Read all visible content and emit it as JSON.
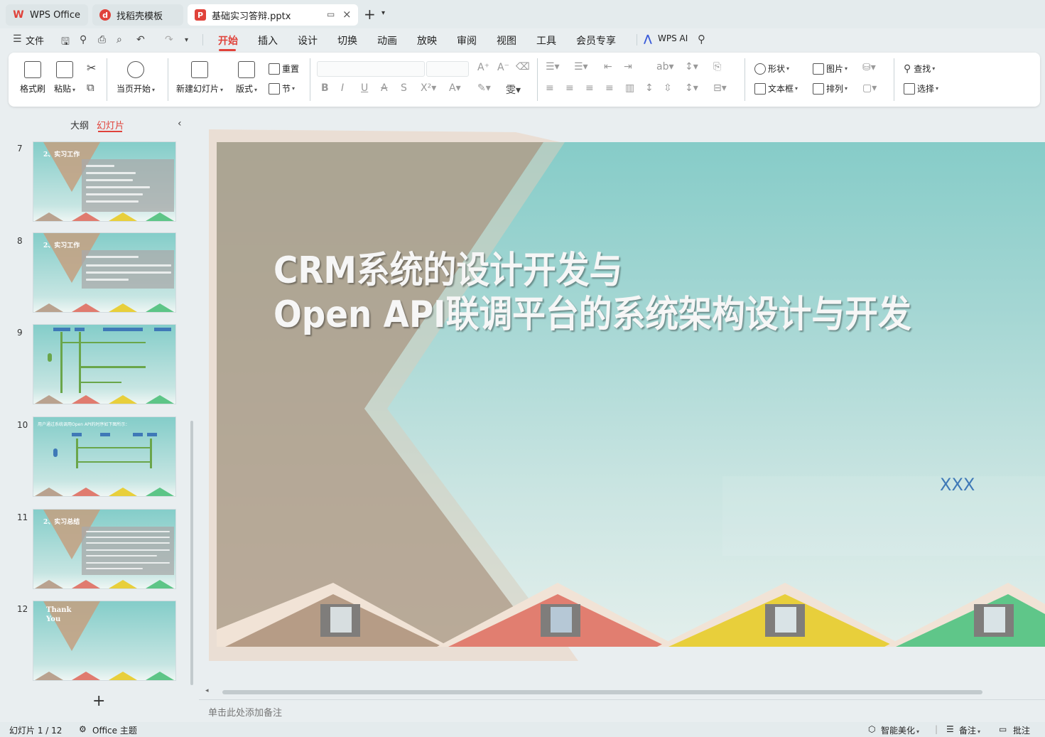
{
  "tabs": [
    {
      "label": "WPS Office",
      "icon": "wps-logo-icon",
      "color": "#e0423a"
    },
    {
      "label": "找稻壳模板",
      "icon": "docer-logo-icon",
      "color": "#e0423a"
    },
    {
      "label": "基础实习答辩.pptx",
      "icon": "ppt-file-icon",
      "color": "#e0423a",
      "active": true
    }
  ],
  "menu": {
    "file_label": "文件",
    "items": [
      "开始",
      "插入",
      "设计",
      "切换",
      "动画",
      "放映",
      "审阅",
      "视图",
      "工具",
      "会员专享"
    ],
    "active": "开始",
    "wps_ai_label": "WPS AI"
  },
  "ribbon": {
    "format_painter": "格式刷",
    "paste": "粘贴",
    "from_current": "当页开始",
    "new_slide": "新建幻灯片",
    "layout": "版式",
    "reset": "重置",
    "section": "节",
    "shape": "形状",
    "textbox": "文本框",
    "picture": "图片",
    "arrange": "排列",
    "find": "查找",
    "select": "选择"
  },
  "panel": {
    "outline_tab": "大纲",
    "slides_tab": "幻灯片",
    "thumbnails": [
      {
        "num": "7",
        "title": "2、实习工作"
      },
      {
        "num": "8",
        "title": "2、实习工作"
      },
      {
        "num": "9",
        "title": ""
      },
      {
        "num": "10",
        "title": "用户通过系统调用Open API的时序如下图所示："
      },
      {
        "num": "11",
        "title": "2、实习总结"
      },
      {
        "num": "12",
        "title": "Thank You"
      }
    ]
  },
  "slide": {
    "title_line1": "CRM系统的设计开发与",
    "title_line2": "Open API联调平台的系统架构设计与开发",
    "author": "XXX"
  },
  "notes": {
    "placeholder": "单击此处添加备注"
  },
  "status": {
    "slide_counter": "幻灯片 1 / 12",
    "theme": "Office 主题",
    "beautify": "智能美化",
    "notes": "备注",
    "comments": "批注"
  },
  "colors": {
    "accent": "#e0423a",
    "author_blue": "#3f79b7"
  }
}
